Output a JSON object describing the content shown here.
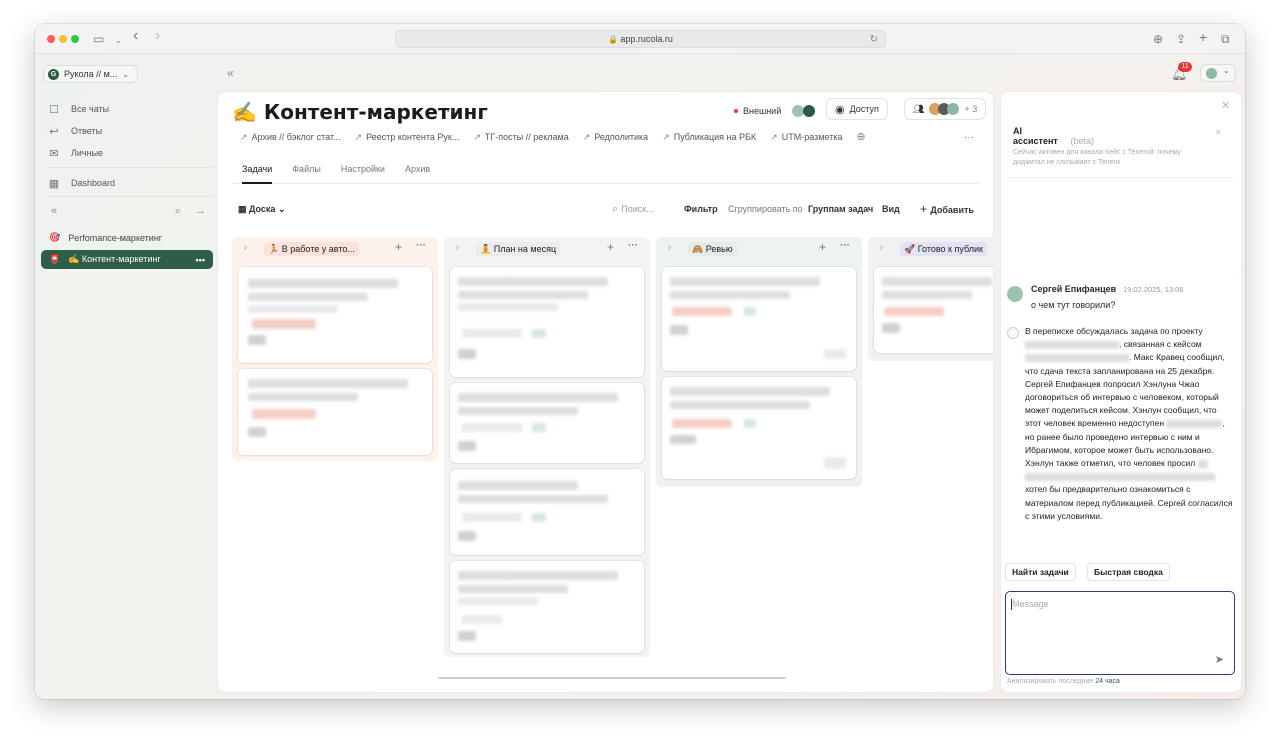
{
  "browser": {
    "url": "app.rucola.ru",
    "reload_icon": "↻",
    "sidebar_toggle_icon": "▭",
    "back_icon": "‹",
    "forward_icon": "›",
    "download_icon": "⊕",
    "share_icon": "⇪",
    "new_tab_icon": "+",
    "tabs_icon": "⧉"
  },
  "workspace": {
    "name": "Рукола // м...",
    "logo": "G"
  },
  "sidebar": {
    "collapse_icon": "«",
    "nav": [
      {
        "label": "Все чаты",
        "icon": "☐"
      },
      {
        "label": "Ответы",
        "icon": "↩"
      },
      {
        "label": "Личные",
        "icon": "✉"
      }
    ],
    "dashboard": {
      "label": "Dashboard",
      "icon": "▦"
    },
    "projects_collapse": "«",
    "projects": [
      {
        "label": "Perfomance-маркетинг",
        "icon": "🎯"
      },
      {
        "label": "✍️ Контент-маркетинг",
        "icon": "📮",
        "more": "•••"
      }
    ]
  },
  "topbar": {
    "collapse": "«",
    "notifications_count": "11"
  },
  "main": {
    "title": "✍️ Контент-маркетинг",
    "title_menu": "···",
    "visibility": "Внешний",
    "access_label": "Доступ",
    "members_extra": "+ 3",
    "links": [
      "Архив // бэклог стат...",
      "Реестр контента Рук...",
      "ТГ-посты // реклама",
      "Редполитика",
      "Публикация на РБК",
      "UTM-разметка"
    ],
    "links_more": "···",
    "tabs": [
      "Задачи",
      "Файлы",
      "Настройки",
      "Архив"
    ],
    "toolbar": {
      "view_label": "Доска",
      "search_placeholder": "Поиск...",
      "filter": "Фильтр",
      "group_prefix": "Сгруппировать по",
      "group_value": "Группам задач",
      "view": "Вид",
      "add": "Добавить"
    },
    "columns": [
      {
        "title": "В работе у авто...",
        "emoji": "🏃",
        "tag_color": "#fbe3dc",
        "bg": "#fdf1ec",
        "cards": 2
      },
      {
        "title": "План на месяц",
        "emoji": "🧘",
        "tag_color": "#ececec",
        "bg": "#f3f3f2",
        "cards": 4
      },
      {
        "title": "Ревью",
        "emoji": "🙈",
        "tag_color": "#e4ece6",
        "bg": "#eef3ef",
        "cards": 2
      },
      {
        "title": "Готово к публик",
        "emoji": "🚀",
        "tag_color": "#e4e3f5",
        "bg": "#f1f1f4",
        "cards": 1
      }
    ]
  },
  "ai_panel": {
    "title": "AI ассистент",
    "beta": "(beta)",
    "subtitle": "Сейчас активен для канала Кейс с Телегой: почему диджитал не слизывает с Телеги",
    "user_message": {
      "author": "Сергей Епифанцев",
      "time": "19.02.2025, 13:06",
      "text": "о чем тут говорили?"
    },
    "ai_message": {
      "p1": "В переписке обсуждалась задача по проекту",
      "p2": "связанная с кейсом",
      "p3": "Макс Кравец сообщил, что сдача текста запланирована на 25 декабря. Сергей Епифанцев попросил Хэнлуна Чжао договориться об интервью с человеком, который может поделиться кейсом. Хэнлун сообщил, что этот человек временно недоступен",
      "p4": "но ранее было проведено интервью с ним и Ибрагимом, которое может быть использовано. Хэнлун также отметил, что человек просил",
      "p5": "хотел бы предварительно ознакомиться с материалом перед публикацией. Сергей согласился с этими условиями."
    },
    "chips": [
      "Найти задачи",
      "Быстрая сводка"
    ],
    "input_placeholder": "Message",
    "send_icon": "➤",
    "analyze_prefix": "Анализировать последние",
    "analyze_value": "24 часа"
  }
}
